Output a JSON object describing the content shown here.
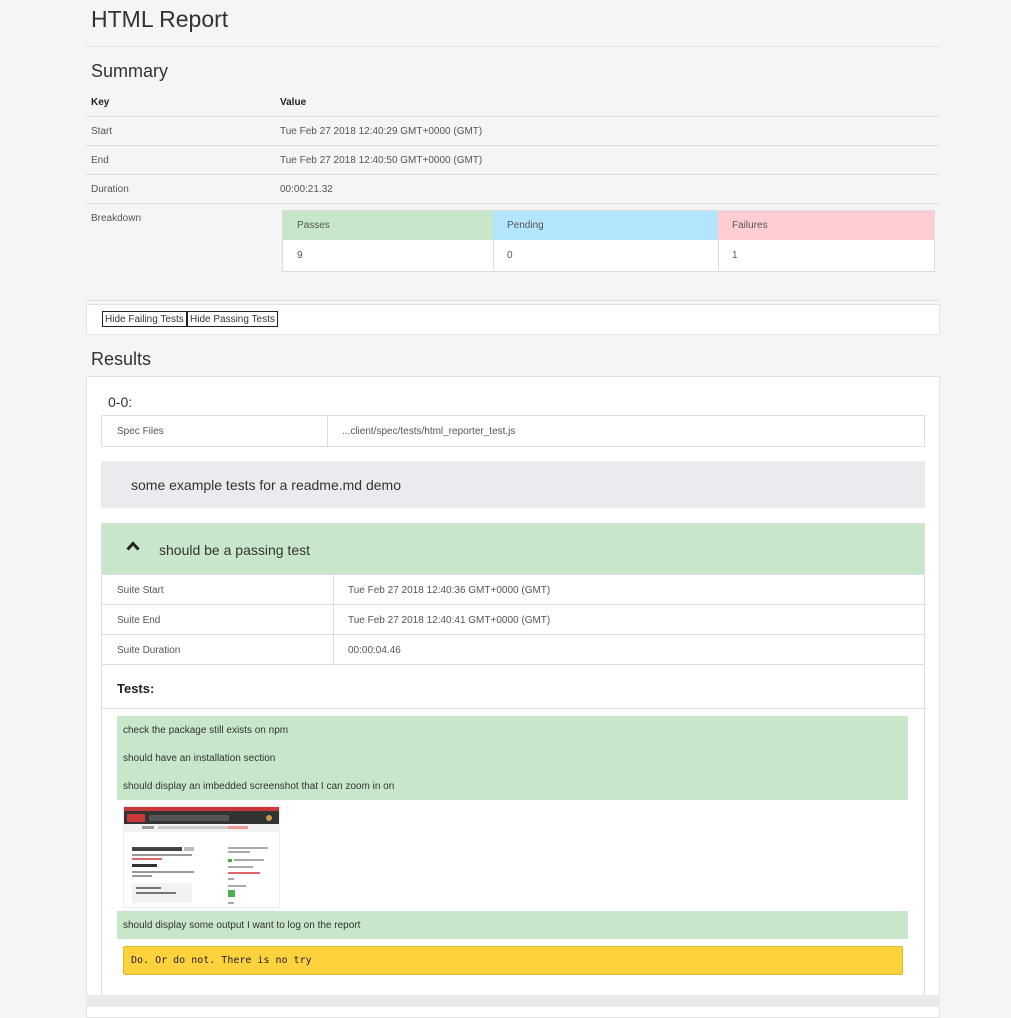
{
  "title": "HTML Report",
  "summary": {
    "heading": "Summary",
    "key_header": "Key",
    "value_header": "Value",
    "rows": [
      {
        "key": "Start",
        "value": "Tue Feb 27 2018 12:40:29 GMT+0000 (GMT)"
      },
      {
        "key": "End",
        "value": "Tue Feb 27 2018 12:40:50 GMT+0000 (GMT)"
      },
      {
        "key": "Duration",
        "value": "00:00:21.32"
      }
    ],
    "breakdown_label": "Breakdown",
    "breakdown": {
      "passes_label": "Passes",
      "passes": "9",
      "pending_label": "Pending",
      "pending": "0",
      "failures_label": "Failures",
      "failures": "1"
    }
  },
  "toolbar": {
    "hide_failing": "Hide Failing Tests",
    "hide_passing": "Hide Passing Tests"
  },
  "results": {
    "heading": "Results",
    "suite_id": "0-0:",
    "spec_files_label": "Spec Files",
    "spec_files_value": "...client/spec/tests/html_reporter_test.js",
    "describe": "some example tests for a readme.md demo",
    "suite": {
      "name": "should be a passing test",
      "start_label": "Suite Start",
      "start": "Tue Feb 27 2018 12:40:36 GMT+0000 (GMT)",
      "end_label": "Suite End",
      "end": "Tue Feb 27 2018 12:40:41 GMT+0000 (GMT)",
      "duration_label": "Suite Duration",
      "duration": "00:00:04.46",
      "tests_label": "Tests:",
      "tests": [
        "check the package still exists on npm",
        "should have an installation section",
        "should display an imbedded screenshot that I can zoom in on"
      ],
      "test_last": "should display some output I want to log on the report",
      "log_output": "Do. Or do not. There is no try"
    }
  },
  "colors": {
    "pass": "#c8e6c9",
    "pending": "#b3e5fc",
    "failure": "#ffcdd2",
    "log": "#fdd23d",
    "describe_bg": "#e9ebee"
  }
}
